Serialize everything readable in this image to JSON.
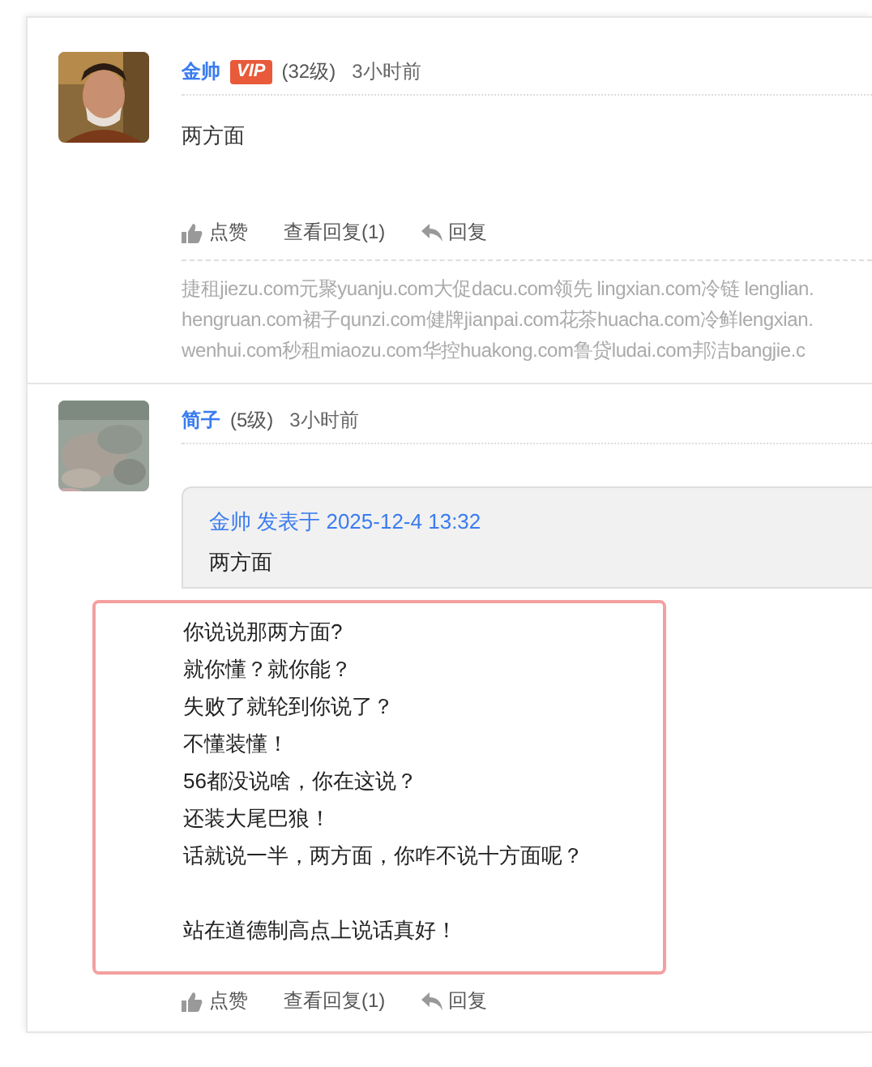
{
  "comments": [
    {
      "avatar": {
        "kind": "picture"
      },
      "author": "金帅",
      "vip_badge": "VIP",
      "level": "(32级)",
      "time": "3小时前",
      "text": "两方面",
      "actions": [
        {
          "kind": "like",
          "label": "点赞"
        },
        {
          "kind": "view",
          "label": "查看回复(1)"
        },
        {
          "kind": "reply",
          "label": "回复"
        }
      ],
      "ad_lines": [
        "捷租jiezu.com元聚yuanju.com大促dacu.com领先 lingxian.com冷链 lenglian.",
        "hengruan.com裙子qunzi.com健牌jianpai.com花茶huacha.com冷鲜lengxian.",
        "wenhui.com秒租miaozu.com华控huakong.com鲁贷ludai.com邦洁bangjie.c"
      ]
    },
    {
      "avatar": {
        "kind": "picture"
      },
      "author": "简子",
      "level": "(5级)",
      "time": "3小时前",
      "quote": {
        "header": "金帅 发表于 2025-12-4 13:32",
        "text": "两方面"
      },
      "highlight_paragraphs": [
        [
          "你说说那两方面?",
          "就你懂？就你能？",
          "失败了就轮到你说了？",
          "不懂装懂！",
          "56都没说啥，你在这说？",
          "还装大尾巴狼！",
          "话就说一半，两方面，你咋不说十方面呢？"
        ],
        [
          "站在道德制高点上说话真好！"
        ]
      ],
      "actions": [
        {
          "kind": "like",
          "label": "点赞"
        },
        {
          "kind": "view",
          "label": "查看回复(1)"
        },
        {
          "kind": "reply",
          "label": "回复"
        }
      ]
    }
  ]
}
